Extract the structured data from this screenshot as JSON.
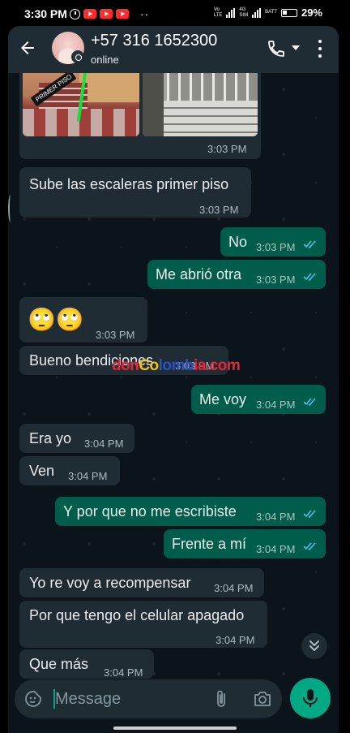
{
  "status_bar": {
    "time": "3:30 PM",
    "dots": "··",
    "network_a": "Vo",
    "network_b": "LTE",
    "network_c": "4G",
    "sim_label": "SIM",
    "batt_label": "BATT",
    "battery_pct": "29%"
  },
  "header": {
    "contact_name": "+57 316 1652300",
    "contact_status": "online"
  },
  "image_message": {
    "photo_label": "PRIMER PISO",
    "time": "3:03 PM"
  },
  "messages": [
    {
      "dir": "in",
      "text": "Sube las escaleras primer piso",
      "time": "3:03 PM"
    },
    {
      "dir": "out",
      "text": "No",
      "time": "3:03 PM"
    },
    {
      "dir": "out",
      "text": "Me abrió otra",
      "time": "3:03 PM"
    },
    {
      "dir": "in",
      "text": "🙄🙄",
      "time": "3:03 PM"
    },
    {
      "dir": "in",
      "text": "Bueno bendiciones",
      "time": "3:03 PM"
    },
    {
      "dir": "out",
      "text": "Me voy",
      "time": "3:04 PM"
    },
    {
      "dir": "in",
      "text": "Era yo",
      "time": "3:04 PM"
    },
    {
      "dir": "in",
      "text": "Ven",
      "time": "3:04 PM"
    },
    {
      "dir": "out",
      "text": "Y por que no me escribiste",
      "time": "3:04 PM"
    },
    {
      "dir": "out",
      "text": "Frente a mí",
      "time": "3:04 PM"
    },
    {
      "dir": "in",
      "text": "Yo re voy a recompensar",
      "time": "3:04 PM"
    },
    {
      "dir": "in",
      "text": "Por que tengo el celular apagado",
      "time": "3:04 PM"
    },
    {
      "dir": "in",
      "text": "Que más",
      "time": "3:04 PM"
    }
  ],
  "watermark": {
    "part_a": "don",
    "part_b": "Co",
    "part_c": "lomb",
    "part_d": "ia.com"
  },
  "input": {
    "placeholder": "Message"
  },
  "colors": {
    "header_bg": "#1f2c34",
    "chat_bg": "#0b141a",
    "incoming_bubble": "#202c33",
    "outgoing_bubble": "#005c4b",
    "read_ticks": "#53bdeb",
    "accent": "#00a884"
  },
  "icons": {
    "back": "arrow-left-icon",
    "call": "phone-icon",
    "menu": "more-vertical-icon",
    "emoji": "sticker-emoji-icon",
    "attach": "paperclip-icon",
    "camera": "camera-icon",
    "mic": "microphone-icon",
    "scroll": "double-chevron-down-icon"
  }
}
